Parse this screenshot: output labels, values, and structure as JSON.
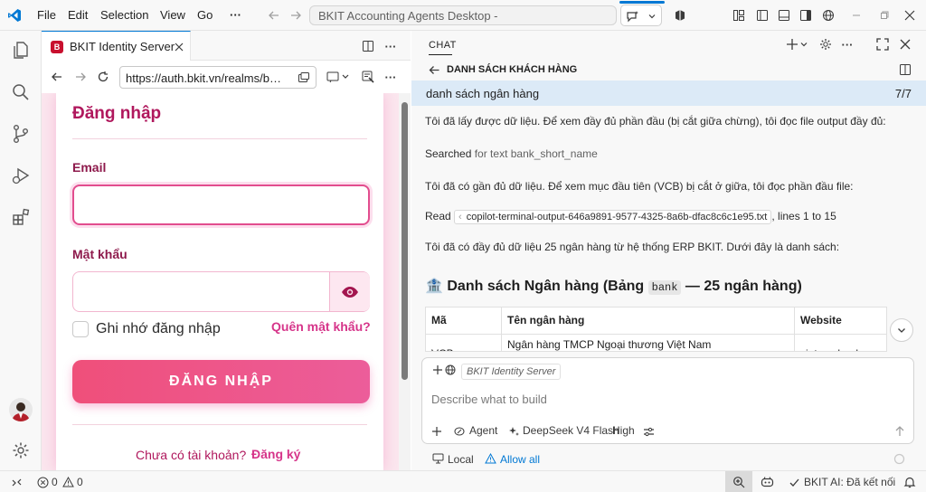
{
  "titlebar": {
    "menus": [
      "File",
      "Edit",
      "Selection",
      "View",
      "Go"
    ],
    "more": "···",
    "command_center": "BKIT Accounting Agents Desktop -"
  },
  "browser": {
    "tab_title": "BKIT Identity Server",
    "url": "https://auth.bkit.vn/realms/bki..."
  },
  "login": {
    "title": "Đăng nhập",
    "email_label": "Email",
    "email_value": "",
    "password_label": "Mật khẩu",
    "password_value": "",
    "remember_label": "Ghi nhớ đăng nhập",
    "forgot_label": "Quên mật khẩu?",
    "submit_label": "ĐĂNG NHẬP",
    "no_account": "Chưa có tài khoản?",
    "register_label": "Đăng ký"
  },
  "chat": {
    "panel_label": "CHAT",
    "session_title": "DANH SÁCH KHÁCH HÀNG",
    "user_query": "danh sách ngân hàng",
    "query_counter": "7/7",
    "msg1": "Tôi đã lấy được dữ liệu. Để xem đầy đủ phần đầu (bị cắt giữa chừng), tôi đọc file output đầy đủ:",
    "searched_prefix": "Searched",
    "searched_text": "for text bank_short_name",
    "msg2": "Tôi đã có gần đủ dữ liệu. Để xem mục đầu tiên (VCB) bị cắt ở giữa, tôi đọc phần đầu file:",
    "read_prefix": "Read",
    "read_file": "copilot-terminal-output-646a9891-9577-4325-8a6b-dfac8c6c1e95.txt",
    "read_suffix": ", lines 1 to 15",
    "msg3": "Tôi đã có đầy đủ dữ liệu 25 ngân hàng từ hệ thống ERP BKIT. Dưới đây là danh sách:",
    "heading_emoji": "🏦",
    "heading_pre": "Danh sách Ngân hàng (Bảng",
    "heading_code": "bank",
    "heading_post": "— 25 ngân hàng)",
    "table": {
      "headers": [
        "Mã",
        "Tên ngân hàng",
        "Website"
      ],
      "first_row": [
        "VCB",
        "Ngân hàng TMCP Ngoại thương Việt Nam",
        "vietcombank.com.vn"
      ]
    },
    "input": {
      "context_chip": "BKIT Identity Server",
      "placeholder": "Describe what to build",
      "mode": "Agent",
      "model": "DeepSeek V4 Flash",
      "effort": "High"
    },
    "footer": {
      "location": "Local",
      "permission": "Allow all"
    }
  },
  "statusbar": {
    "errors": "0",
    "warnings": "0",
    "ai_status": "BKIT AI: Đã kết nối"
  },
  "colors": {
    "accent": "#0078d4",
    "brand_pink": "#d6358a",
    "brand_dark": "#b0185d",
    "button_gradient_start": "#ef4f7a",
    "button_gradient_end": "#ec5d9a"
  }
}
